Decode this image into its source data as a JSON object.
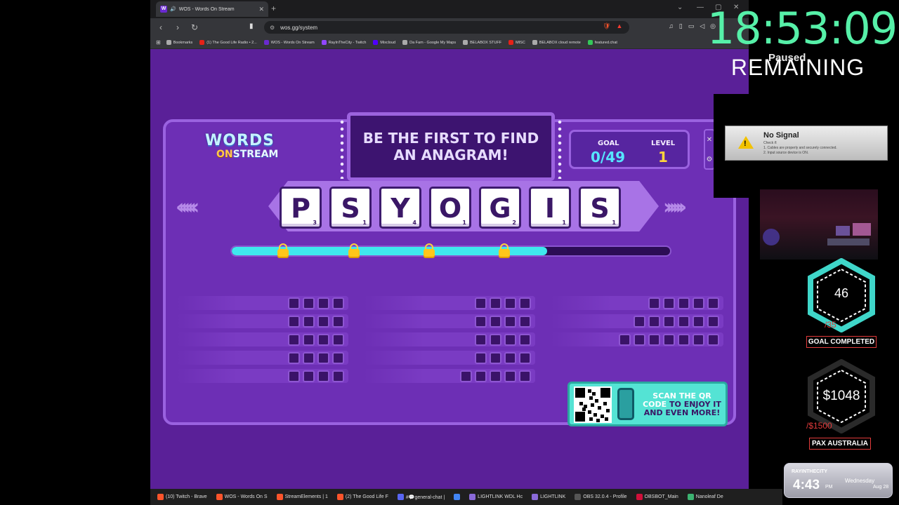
{
  "browser": {
    "tab_title": "WOS - Words On Stream",
    "tab_favicon": "W",
    "url": "wos.gg/system",
    "bookmarks": [
      {
        "label": "Bookmarks",
        "color": "#aaaaaa"
      },
      {
        "label": "(1) The Good Life Radio • 2...",
        "color": "#e62117"
      },
      {
        "label": "WOS - Words On Stream",
        "color": "#6a2ad0"
      },
      {
        "label": "RayInTheCity - Twitch",
        "color": "#9146ff"
      },
      {
        "label": "Mixcloud",
        "color": "#5000ff"
      },
      {
        "label": "Da Fam - Google My Maps",
        "color": "#aaaaaa"
      },
      {
        "label": "BELABOX STUFF",
        "color": "#aaaaaa"
      },
      {
        "label": "MISC",
        "color": "#e62117"
      },
      {
        "label": "BELABOX cloud remote",
        "color": "#aaaaaa"
      },
      {
        "label": "featured.chat",
        "color": "#34c759"
      }
    ]
  },
  "game": {
    "logo": {
      "words": "WORDS",
      "on": "ON",
      "stream": "STREAM"
    },
    "banner": "BE THE FIRST TO FIND AN ANAGRAM!",
    "goal_label": "GOAL",
    "goal_value": "0/49",
    "level_label": "LEVEL",
    "level_value": "1",
    "tiles": [
      {
        "letter": "P",
        "score": "3"
      },
      {
        "letter": "S",
        "score": "1"
      },
      {
        "letter": "Y",
        "score": "4"
      },
      {
        "letter": "O",
        "score": "1"
      },
      {
        "letter": "G",
        "score": "2"
      },
      {
        "letter": "I",
        "score": "1"
      },
      {
        "letter": "S",
        "score": "1"
      }
    ],
    "progress_fraction": 0.72,
    "locks": 4,
    "word_columns": [
      {
        "rows": [
          4,
          4,
          4,
          4,
          4
        ]
      },
      {
        "rows": [
          4,
          4,
          4,
          4,
          5
        ]
      },
      {
        "rows": [
          5,
          6,
          7
        ]
      }
    ],
    "qr": {
      "line1": "SCAN THE QR",
      "line2a": "CODE",
      "line2b": " TO ENJOY IT",
      "line3": "AND EVEN MORE!"
    }
  },
  "overlay": {
    "countdown": "18:53:09",
    "paused": "Paused",
    "remaining": "REMAINING",
    "no_signal": {
      "title": "No Signal",
      "lines": [
        "Check if:",
        "1. Cables are properly and securely connected.",
        "2. Input source device is ON."
      ]
    },
    "hex1": {
      "value": "46",
      "target": "/35",
      "label": "GOAL COMPLETED"
    },
    "hex2": {
      "value": "$1048",
      "target": "/$1500",
      "label": "PAX AUSTRALIA"
    },
    "clock": {
      "brand": "RAYINTHECITY",
      "time": "4:43",
      "ampm": "PM",
      "day": "Wednesday",
      "date": "Aug 28"
    }
  },
  "taskbar": [
    {
      "label": "(10) Twitch - Brave",
      "color": "#fb542b"
    },
    {
      "label": "WOS - Words On S",
      "color": "#fb542b"
    },
    {
      "label": "StreamElements | 1",
      "color": "#fb542b"
    },
    {
      "label": "(2) The Good Life F",
      "color": "#fb542b"
    },
    {
      "label": "#💬general-chat |",
      "color": "#5865f2"
    },
    {
      "label": "",
      "color": "#4285f4"
    },
    {
      "label": "LIGHTLINK WDL Hc",
      "color": "#8a6ad8"
    },
    {
      "label": "LIGHTLINK",
      "color": "#8a6ad8"
    },
    {
      "label": "OBS 32.0.4 - Profile",
      "color": "#555555"
    },
    {
      "label": "OBSBOT_Main",
      "color": "#d0103a"
    },
    {
      "label": "Nanoleaf De",
      "color": "#3cb371"
    }
  ]
}
